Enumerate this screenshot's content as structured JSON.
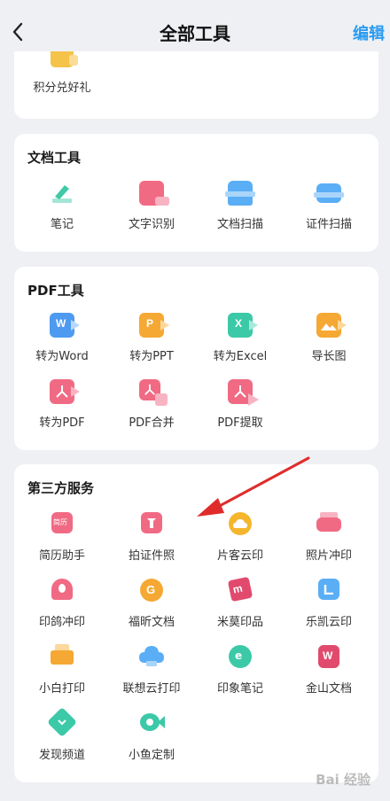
{
  "header": {
    "title": "全部工具",
    "edit_label": "编辑"
  },
  "top_card": {
    "item": {
      "label": "积分兑好礼",
      "icon": "gift-icon"
    }
  },
  "doc_tools": {
    "title": "文档工具",
    "items": [
      {
        "label": "笔记",
        "icon": "pen-icon"
      },
      {
        "label": "文字识别",
        "icon": "ocr-icon"
      },
      {
        "label": "文档扫描",
        "icon": "document-scan-icon"
      },
      {
        "label": "证件扫描",
        "icon": "id-scan-icon"
      }
    ]
  },
  "pdf_tools": {
    "title": "PDF工具",
    "items": [
      {
        "label": "转为Word",
        "icon": "word-icon"
      },
      {
        "label": "转为PPT",
        "icon": "ppt-icon"
      },
      {
        "label": "转为Excel",
        "icon": "excel-icon"
      },
      {
        "label": "导长图",
        "icon": "long-image-icon"
      },
      {
        "label": "转为PDF",
        "icon": "pdf-icon"
      },
      {
        "label": "PDF合并",
        "icon": "pdf-merge-icon"
      },
      {
        "label": "PDF提取",
        "icon": "pdf-extract-icon"
      }
    ]
  },
  "third_party": {
    "title": "第三方服务",
    "items": [
      {
        "label": "简历助手",
        "icon": "resume-icon"
      },
      {
        "label": "拍证件照",
        "icon": "id-photo-icon"
      },
      {
        "label": "片客云印",
        "icon": "cloud-print-icon"
      },
      {
        "label": "照片冲印",
        "icon": "photo-print-icon"
      },
      {
        "label": "印鸽冲印",
        "icon": "pigeon-print-icon"
      },
      {
        "label": "福昕文档",
        "icon": "foxit-icon"
      },
      {
        "label": "米莫印品",
        "icon": "mimo-icon"
      },
      {
        "label": "乐凯云印",
        "icon": "lucky-print-icon"
      },
      {
        "label": "小白打印",
        "icon": "printer-icon"
      },
      {
        "label": "联想云打印",
        "icon": "lenovo-cloud-icon"
      },
      {
        "label": "印象笔记",
        "icon": "evernote-icon"
      },
      {
        "label": "金山文档",
        "icon": "wps-icon"
      },
      {
        "label": "发现频道",
        "icon": "discover-icon"
      },
      {
        "label": "小鱼定制",
        "icon": "fish-icon"
      }
    ]
  },
  "watermark": "Bai 经验",
  "colors": {
    "accent": "#2a9bf2",
    "arrow": "#e02b2b",
    "background": "#eef0f4"
  }
}
